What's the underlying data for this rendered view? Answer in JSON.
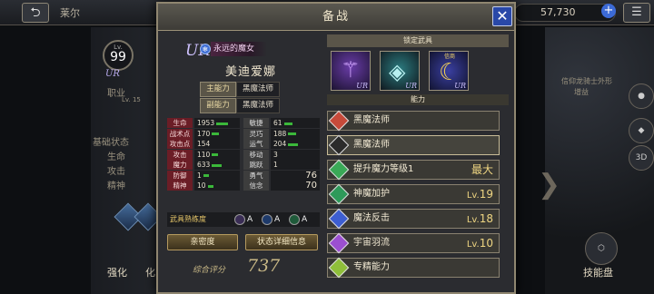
{
  "topbar": {
    "back_icon": "back-arrow-icon",
    "title": "莱尔",
    "gem_count": "57,730",
    "plus_icon": "plus-icon",
    "menu_icon": "menu-icon"
  },
  "background": {
    "level_prefix": "Lv.",
    "level": "99",
    "rarity": "UR",
    "labels": [
      "职业",
      "基础状态",
      "生命",
      "攻击",
      "精神"
    ],
    "small_lv": "Lv. 15",
    "left_buttons": [
      "强化",
      "化"
    ],
    "right_buttons": [
      "技能盘"
    ],
    "right_icons": [
      "3D"
    ],
    "right_notes": [
      "信仰龙骑士外形",
      "增益"
    ]
  },
  "modal": {
    "title": "备战",
    "close_icon": "close-icon",
    "character": {
      "rarity": "UR",
      "element_icon": "snowflake-icon",
      "epithet": "永远的魔女",
      "name": "美迪爱娜",
      "main_ability_label": "主能力",
      "main_ability_value": "黑魔法师",
      "sub_ability_label": "副能力",
      "sub_ability_value": "黑魔法师"
    },
    "stats": [
      {
        "name": "生命",
        "value": "1953",
        "bar": 0.6,
        "name2": "敏捷",
        "value2": "61",
        "bar2": 0.45
      },
      {
        "name": "战术点",
        "value": "170",
        "bar": 0.35,
        "name2": "灵巧",
        "value2": "188",
        "bar2": 0.4
      },
      {
        "name": "攻击点",
        "value": "154",
        "bar": 0,
        "name2": "运气",
        "value2": "204",
        "bar2": 0.5
      },
      {
        "name": "攻击",
        "value": "110",
        "bar": 0.3,
        "name2": "移动",
        "value2": "3",
        "bar2": 0
      },
      {
        "name": "魔力",
        "value": "633",
        "bar": 0.5,
        "name2": "跳跃",
        "value2": "1",
        "bar2": 0
      },
      {
        "name": "防御",
        "value": "1",
        "bar": 0.3,
        "name2": "勇气",
        "value2": "76",
        "bar2": 0
      },
      {
        "name": "精神",
        "value": "10",
        "bar": 0.3,
        "name2": "信念",
        "value2": "70",
        "bar2": 0
      }
    ],
    "weapon_mastery": {
      "label": "武具熟练度",
      "grades": [
        {
          "icon": "staff-icon",
          "grade": "A"
        },
        {
          "icon": "magic-orb-icon",
          "grade": "A"
        },
        {
          "icon": "nature-icon",
          "grade": "A"
        }
      ]
    },
    "buttons": {
      "intimacy": "亲密度",
      "status_detail": "状态详细信息"
    },
    "score": {
      "label": "综合评分",
      "value": "737"
    },
    "locked_weapons": {
      "title": "锁定武具",
      "slots": [
        {
          "icon": "staff-weapon-icon",
          "tag": "",
          "rarity": "UR"
        },
        {
          "icon": "orb-weapon-icon",
          "tag": "",
          "rarity": "UR"
        },
        {
          "icon": "crescent-weapon-icon",
          "tag": "信商",
          "rarity": "UR"
        }
      ]
    },
    "abilities_title": "能力",
    "abilities": [
      {
        "icon": "black-mage-icon",
        "name": "黑魔法师",
        "lv_prefix": "",
        "lv": "",
        "color": "#c74a3a"
      },
      {
        "icon": "black-mage-icon",
        "name": "黑魔法师",
        "lv_prefix": "",
        "lv": "",
        "color": "#2b2b2b"
      },
      {
        "icon": "magic-up-icon",
        "name": "提升魔力等级1",
        "lv_prefix": "",
        "lv": "最大",
        "color": "#3aa957"
      },
      {
        "icon": "divine-protect-icon",
        "name": "神魔加护",
        "lv_prefix": "Lv.",
        "lv": "19",
        "color": "#2e9a5a"
      },
      {
        "icon": "magic-counter-icon",
        "name": "魔法反击",
        "lv_prefix": "Lv.",
        "lv": "18",
        "color": "#3d5ed1"
      },
      {
        "icon": "cosmic-wing-icon",
        "name": "宇宙羽流",
        "lv_prefix": "Lv.",
        "lv": "10",
        "color": "#9b4fd0"
      },
      {
        "icon": "mastery-icon",
        "name": "专精能力",
        "lv_prefix": "",
        "lv": "",
        "color": "#8fbf3a"
      }
    ]
  }
}
